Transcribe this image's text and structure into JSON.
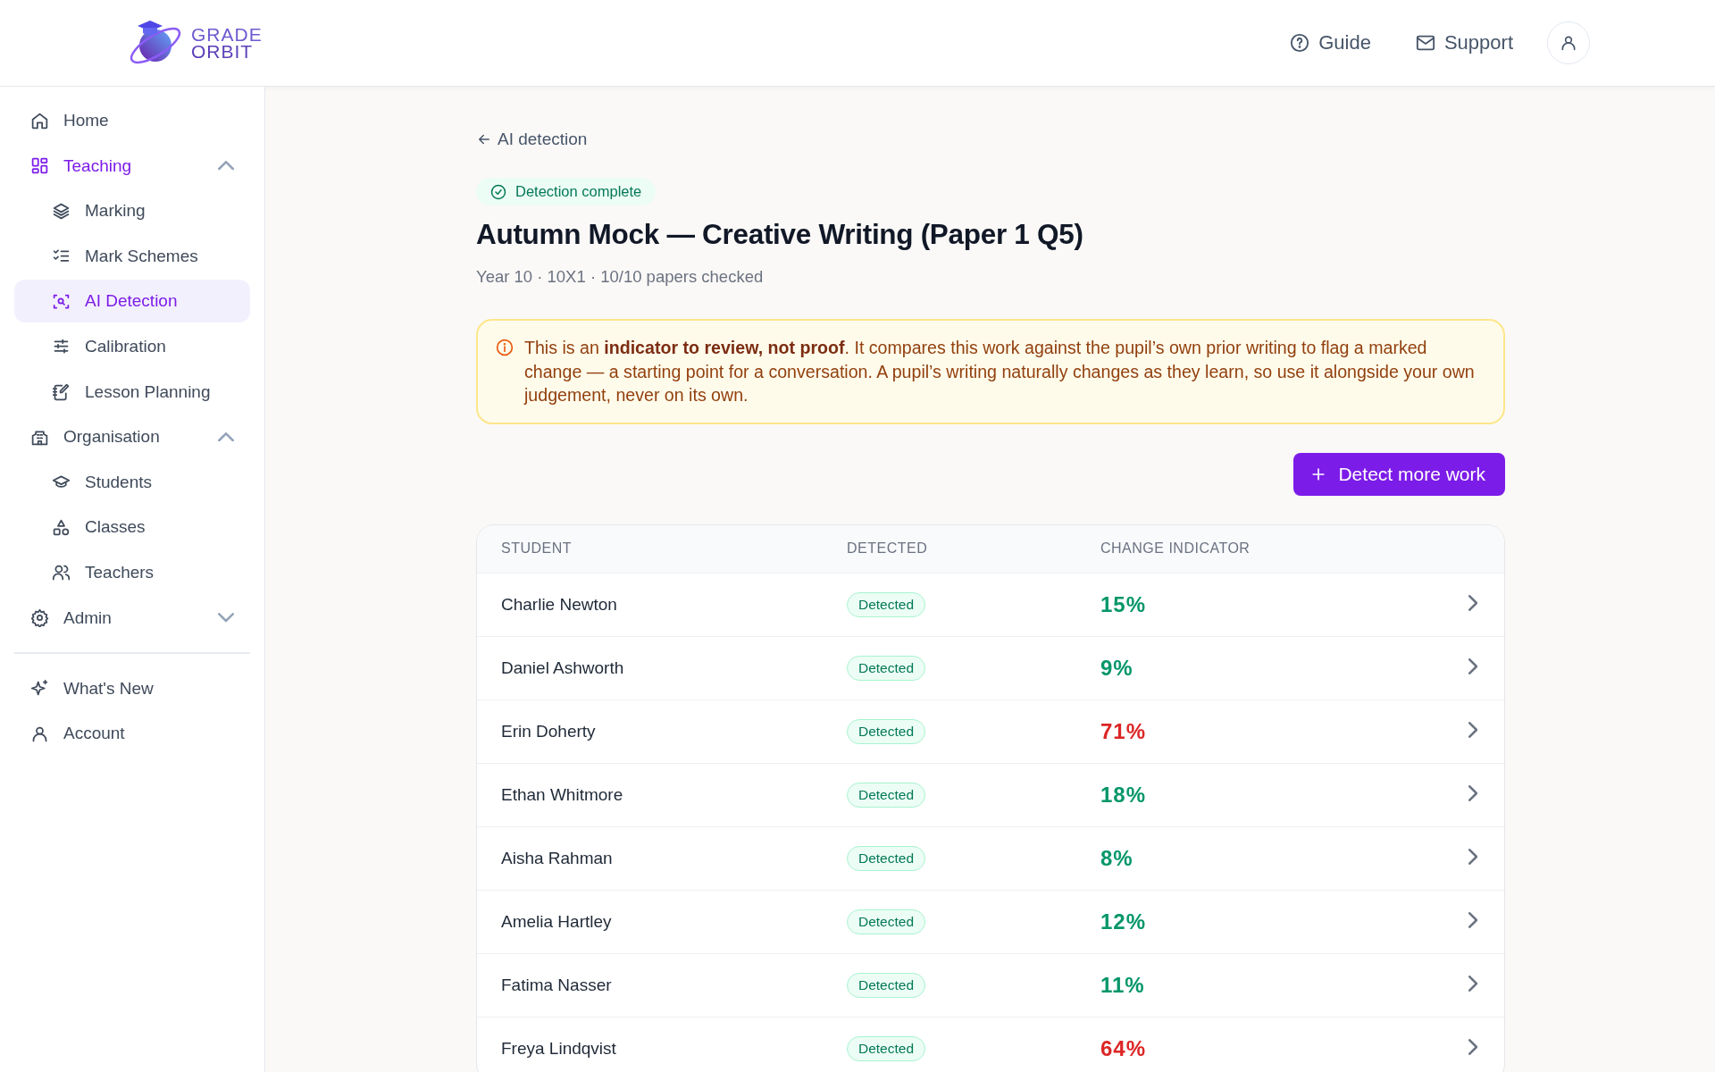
{
  "header": {
    "logo_lines": [
      "GRADE",
      "ORBIT"
    ],
    "links": [
      "Guide",
      "Support"
    ]
  },
  "sidebar": {
    "items": [
      {
        "label": "Home",
        "selected": false
      },
      {
        "label": "Teaching",
        "selected": true,
        "expanded": true,
        "children": [
          {
            "label": "Marking",
            "selected": false
          },
          {
            "label": "Mark Schemes",
            "selected": false
          },
          {
            "label": "AI Detection",
            "selected": true
          },
          {
            "label": "Calibration",
            "selected": false
          },
          {
            "label": "Lesson Planning",
            "selected": false
          }
        ]
      },
      {
        "label": "Organisation",
        "selected": false,
        "expanded": true,
        "children": [
          {
            "label": "Students",
            "selected": false
          },
          {
            "label": "Classes",
            "selected": false
          },
          {
            "label": "Teachers",
            "selected": false
          }
        ]
      },
      {
        "label": "Admin",
        "selected": false,
        "expanded": false
      }
    ],
    "footer_items": [
      {
        "label": "What's New",
        "selected": false
      },
      {
        "label": "Account",
        "selected": false
      }
    ]
  },
  "back_link": "AI detection",
  "status_badge": "Detection complete",
  "title": "Autumn Mock — Creative Writing (Paper 1 Q5)",
  "subtitle": "Year 10 · 10X1 · 10/10 papers checked",
  "notice": "This is an **indicator to review, not proof**. It compares this work against the pupil’s own prior writing to flag a marked change — a starting point for a conversation. A pupil’s writing naturally changes as they learn, so use it alongside your own judgement, never on its own.",
  "primary_button": "Detect more work",
  "table": {
    "columns": [
      "STUDENT",
      "DETECTED",
      "CHANGE INDICATOR"
    ],
    "rows": [
      {
        "student": "Charlie Newton",
        "detected": "Detected",
        "change": "15%",
        "flagged": false
      },
      {
        "student": "Daniel Ashworth",
        "detected": "Detected",
        "change": "9%",
        "flagged": false
      },
      {
        "student": "Erin Doherty",
        "detected": "Detected",
        "change": "71%",
        "flagged": true
      },
      {
        "student": "Ethan Whitmore",
        "detected": "Detected",
        "change": "18%",
        "flagged": false
      },
      {
        "student": "Aisha Rahman",
        "detected": "Detected",
        "change": "8%",
        "flagged": false
      },
      {
        "student": "Amelia Hartley",
        "detected": "Detected",
        "change": "12%",
        "flagged": false
      },
      {
        "student": "Fatima Nasser",
        "detected": "Detected",
        "change": "11%",
        "flagged": false
      },
      {
        "student": "Freya Lindqvist",
        "detected": "Detected",
        "change": "64%",
        "flagged": true
      }
    ]
  }
}
